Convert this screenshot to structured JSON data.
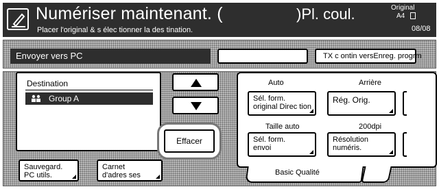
{
  "header": {
    "title": "Numériser maintenant. (",
    "subtitle": "Placer l'original & s élec tionner la des tination.",
    "right_text": ")Pl. coul.",
    "original_label": "Original",
    "original_size": "A4",
    "page_count": "08/08"
  },
  "modebar": {
    "mode_label": "Envoyer vers PC",
    "tx_button_label": "TX c ontin versEnreg. progrm"
  },
  "destination": {
    "header": "Destination",
    "items": [
      {
        "label": "Group A",
        "icon": "group-icon"
      }
    ]
  },
  "navigation": {
    "up_icon": "arrow-up-icon",
    "down_icon": "arrow-down-icon",
    "clear_label": "Effacer"
  },
  "bottom_buttons": {
    "save_label_1": "Sauvegard.",
    "save_label_2": "PC utils.",
    "book_label_1": "Carnet",
    "book_label_2": "d'adres ses"
  },
  "settings": {
    "format_value": "Auto",
    "format_line1": "Sél. form.",
    "format_line2": "original Direc tion",
    "background_value": "Arrière",
    "background_label": "Rég. Orig.",
    "send_size_value": "Taille auto",
    "send_line1": "Sél. form.",
    "send_line2": "envoi",
    "resolution_value": "200dpi",
    "resolution_line1": "Résolution",
    "resolution_line2": "numéris.",
    "tab_label": "Basic Qualité"
  }
}
